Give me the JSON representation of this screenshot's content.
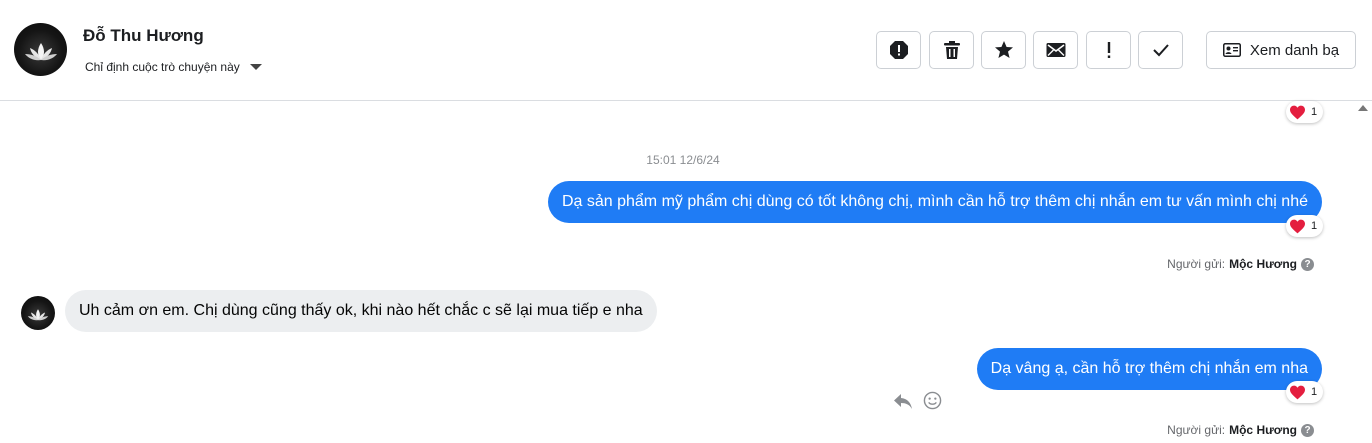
{
  "header": {
    "contact_name": "Đỗ Thu Hương",
    "assign_label": "Chỉ định cuộc trò chuyện này",
    "toolbar": [
      {
        "name": "mark-spam-button",
        "icon": "alert-octagon-icon"
      },
      {
        "name": "delete-button",
        "icon": "trash-icon"
      },
      {
        "name": "star-button",
        "icon": "star-icon"
      },
      {
        "name": "mark-unread-button",
        "icon": "envelope-icon"
      },
      {
        "name": "important-button",
        "icon": "exclamation-icon"
      },
      {
        "name": "done-button",
        "icon": "check-icon"
      }
    ],
    "contacts_label": "Xem danh bạ"
  },
  "chat": {
    "top_reaction": {
      "emoji": "heart",
      "count": "1"
    },
    "timestamp": "15:01 12/6/24",
    "messages": [
      {
        "direction": "out",
        "text": "Dạ sản phẩm mỹ phẩm chị dùng có tốt không chị, mình cần hỗ trợ thêm chị nhắn em tư vấn mình chị nhé",
        "reaction_count": "1",
        "sender_prefix": "Người gửi:",
        "sender_name": "Mộc Hương"
      },
      {
        "direction": "in",
        "text": "Uh cảm ơn em. Chị dùng cũng thấy ok, khi nào hết chắc c sẽ lại mua tiếp e nha"
      },
      {
        "direction": "out",
        "text": "Dạ vâng ạ, cần hỗ trợ thêm chị nhắn em nha",
        "reaction_count": "1",
        "sender_prefix": "Người gửi:",
        "sender_name": "Mộc Hương"
      }
    ]
  },
  "colors": {
    "outgoing_bubble": "#1f7cf5",
    "incoming_bubble": "#eceef0",
    "heart": "#e41e3f"
  }
}
